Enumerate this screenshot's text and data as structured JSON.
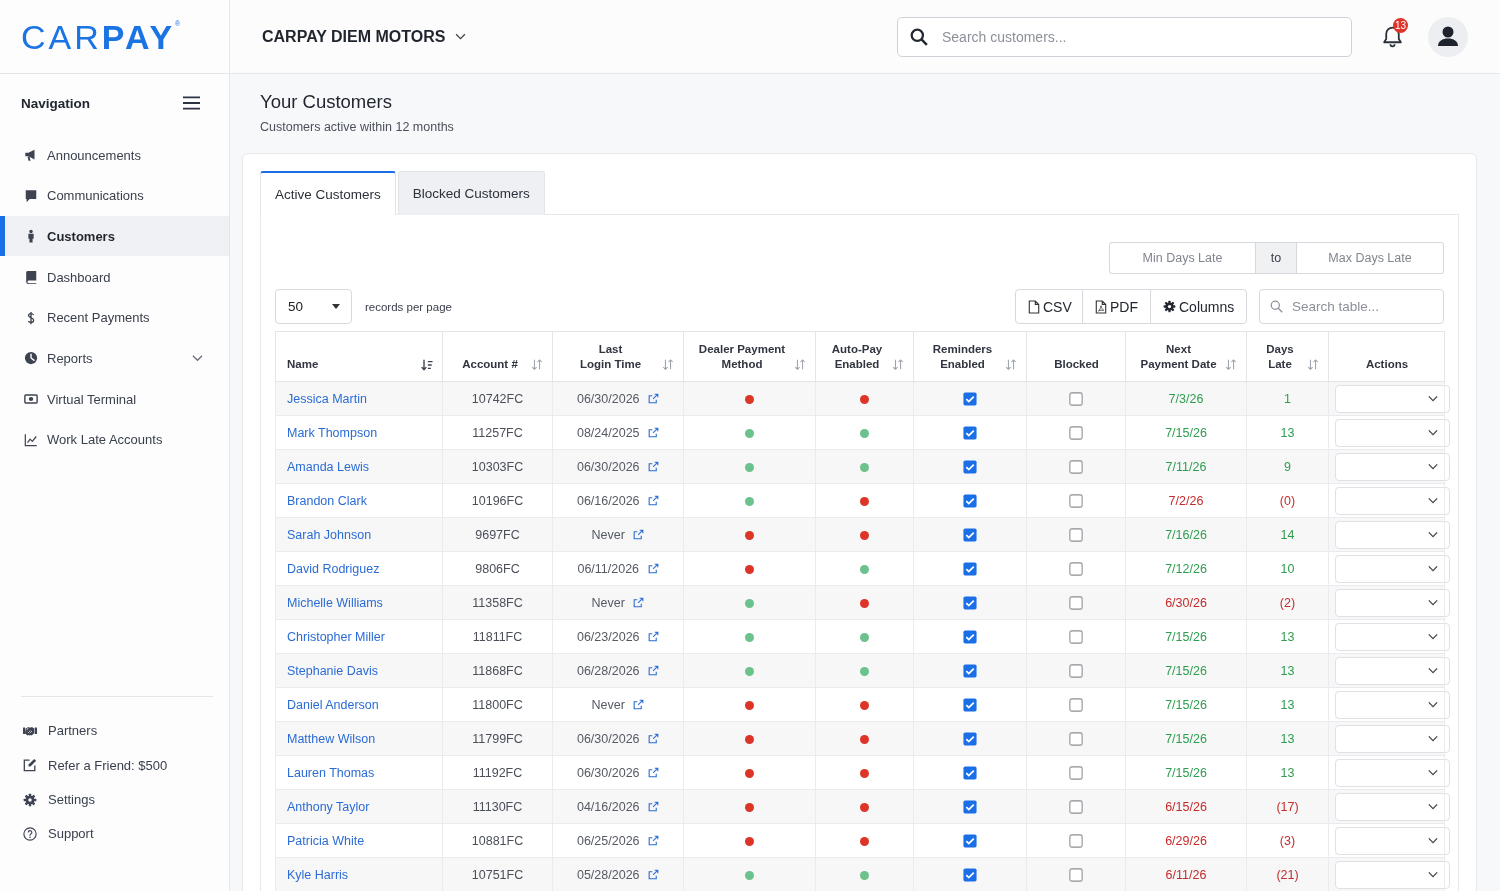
{
  "logo": "CAR**PAY**$^{®}$",
  "dealer_selector": {
    "label": "CARPAY DIEM MOTORS"
  },
  "search": {
    "placeholder": "Search customers..."
  },
  "notifications": {
    "count": "13"
  },
  "sidebar": {
    "heading": "Navigation",
    "items": [
      {
        "label": "Announcements",
        "kind": "link",
        "selected": false
      },
      {
        "label": "Communications",
        "kind": "link",
        "selected": false
      },
      {
        "label": "Customers",
        "kind": "link",
        "selected": true
      },
      {
        "label": "Dashboard",
        "kind": "link",
        "selected": false
      },
      {
        "label": "Recent Payments",
        "kind": "link",
        "selected": false
      },
      {
        "label": "Reports",
        "kind": "group",
        "selected": false,
        "expanded": false
      },
      {
        "label": "Virtual Terminal",
        "kind": "link",
        "selected": false
      },
      {
        "label": "Work Late Accounts",
        "kind": "link",
        "selected": false
      }
    ],
    "footer_items": [
      {
        "label": "Partners"
      },
      {
        "label": "Refer a Friend: $500"
      },
      {
        "label": "Settings"
      },
      {
        "label": "Support"
      }
    ]
  },
  "page": {
    "title": "Your Customers",
    "subtitle": "Customers active within 12 months"
  },
  "tabs": [
    {
      "label": "Active Customers",
      "selected": true
    },
    {
      "label": "Blocked Customers",
      "selected": false
    }
  ],
  "days_late_filter": {
    "min_placeholder": "Min Days Late",
    "separator": "to",
    "max_placeholder": "Max Days Late"
  },
  "page_size": {
    "value": "50",
    "label": "records per page"
  },
  "export_buttons": [
    "CSV",
    "PDF",
    "Columns"
  ],
  "table_search": {
    "placeholder": "Search table..."
  },
  "table": {
    "columns": [
      {
        "label": "Name",
        "sortable": true,
        "sorted": true
      },
      {
        "label": "Account #",
        "sortable": true,
        "sorted": false
      },
      {
        "label": "Last\nLogin Time",
        "sortable": true,
        "sorted": false
      },
      {
        "label": "Dealer Payment\nMethod",
        "sortable": true,
        "sorted": false
      },
      {
        "label": "Auto-Pay\nEnabled",
        "sortable": true,
        "sorted": false
      },
      {
        "label": "Reminders\nEnabled",
        "sortable": true,
        "sorted": false
      },
      {
        "label": "Blocked",
        "sortable": false,
        "sorted": false
      },
      {
        "label": "Next\nPayment Date",
        "sortable": true,
        "sorted": false
      },
      {
        "label": "Days\nLate",
        "sortable": true,
        "sorted": false
      },
      {
        "label": "Actions",
        "sortable": false,
        "sorted": false
      }
    ],
    "rows": [
      {
        "name": "Jessica Martin",
        "account": "10742FC",
        "last_login": "06/30/2026",
        "dealer_payment": {
          "color": "#dd3428"
        },
        "auto_pay": {
          "color": "#dd3428"
        },
        "reminders_enabled": true,
        "blocked": false,
        "next_payment_date": "7/3/26",
        "days_late": "1",
        "past_due": false
      },
      {
        "name": "Mark Thompson",
        "account": "11257FC",
        "last_login": "08/24/2025",
        "dealer_payment": {
          "color": "#6cc28c"
        },
        "auto_pay": {
          "color": "#6cc28c"
        },
        "reminders_enabled": true,
        "blocked": false,
        "next_payment_date": "7/15/26",
        "days_late": "13",
        "past_due": false
      },
      {
        "name": "Amanda Lewis",
        "account": "10303FC",
        "last_login": "06/30/2026",
        "dealer_payment": {
          "color": "#6cc28c"
        },
        "auto_pay": {
          "color": "#6cc28c"
        },
        "reminders_enabled": true,
        "blocked": false,
        "next_payment_date": "7/11/26",
        "days_late": "9",
        "past_due": false
      },
      {
        "name": "Brandon Clark",
        "account": "10196FC",
        "last_login": "06/16/2026",
        "dealer_payment": {
          "color": "#6cc28c"
        },
        "auto_pay": {
          "color": "#dd3428"
        },
        "reminders_enabled": true,
        "blocked": false,
        "next_payment_date": "7/2/26",
        "days_late": "(0)",
        "past_due": true
      },
      {
        "name": "Sarah Johnson",
        "account": "9697FC",
        "last_login": "Never",
        "dealer_payment": {
          "color": "#dd3428"
        },
        "auto_pay": {
          "color": "#dd3428"
        },
        "reminders_enabled": true,
        "blocked": false,
        "next_payment_date": "7/16/26",
        "days_late": "14",
        "past_due": false
      },
      {
        "name": "David Rodriguez",
        "account": "9806FC",
        "last_login": "06/11/2026",
        "dealer_payment": {
          "color": "#dd3428"
        },
        "auto_pay": {
          "color": "#6cc28c"
        },
        "reminders_enabled": true,
        "blocked": false,
        "next_payment_date": "7/12/26",
        "days_late": "10",
        "past_due": false
      },
      {
        "name": "Michelle Williams",
        "account": "11358FC",
        "last_login": "Never",
        "dealer_payment": {
          "color": "#6cc28c"
        },
        "auto_pay": {
          "color": "#dd3428"
        },
        "reminders_enabled": true,
        "blocked": false,
        "next_payment_date": "6/30/26",
        "days_late": "(2)",
        "past_due": true
      },
      {
        "name": "Christopher Miller",
        "account": "11811FC",
        "last_login": "06/23/2026",
        "dealer_payment": {
          "color": "#6cc28c"
        },
        "auto_pay": {
          "color": "#6cc28c"
        },
        "reminders_enabled": true,
        "blocked": false,
        "next_payment_date": "7/15/26",
        "days_late": "13",
        "past_due": false
      },
      {
        "name": "Stephanie Davis",
        "account": "11868FC",
        "last_login": "06/28/2026",
        "dealer_payment": {
          "color": "#6cc28c"
        },
        "auto_pay": {
          "color": "#6cc28c"
        },
        "reminders_enabled": true,
        "blocked": false,
        "next_payment_date": "7/15/26",
        "days_late": "13",
        "past_due": false
      },
      {
        "name": "Daniel Anderson",
        "account": "11800FC",
        "last_login": "Never",
        "dealer_payment": {
          "color": "#dd3428"
        },
        "auto_pay": {
          "color": "#dd3428"
        },
        "reminders_enabled": true,
        "blocked": false,
        "next_payment_date": "7/15/26",
        "days_late": "13",
        "past_due": false
      },
      {
        "name": "Matthew Wilson",
        "account": "11799FC",
        "last_login": "06/30/2026",
        "dealer_payment": {
          "color": "#dd3428"
        },
        "auto_pay": {
          "color": "#dd3428"
        },
        "reminders_enabled": true,
        "blocked": false,
        "next_payment_date": "7/15/26",
        "days_late": "13",
        "past_due": false
      },
      {
        "name": "Lauren Thomas",
        "account": "11192FC",
        "last_login": "06/30/2026",
        "dealer_payment": {
          "color": "#dd3428"
        },
        "auto_pay": {
          "color": "#dd3428"
        },
        "reminders_enabled": true,
        "blocked": false,
        "next_payment_date": "7/15/26",
        "days_late": "13",
        "past_due": false
      },
      {
        "name": "Anthony Taylor",
        "account": "11130FC",
        "last_login": "04/16/2026",
        "dealer_payment": {
          "color": "#dd3428"
        },
        "auto_pay": {
          "color": "#dd3428"
        },
        "reminders_enabled": true,
        "blocked": false,
        "next_payment_date": "6/15/26",
        "days_late": "(17)",
        "past_due": true
      },
      {
        "name": "Patricia White",
        "account": "10881FC",
        "last_login": "06/25/2026",
        "dealer_payment": {
          "color": "#dd3428"
        },
        "auto_pay": {
          "color": "#dd3428"
        },
        "reminders_enabled": true,
        "blocked": false,
        "next_payment_date": "6/29/26",
        "days_late": "(3)",
        "past_due": true
      },
      {
        "name": "Kyle Harris",
        "account": "10751FC",
        "last_login": "05/28/2026",
        "dealer_payment": {
          "color": "#6cc28c"
        },
        "auto_pay": {
          "color": "#6cc28c"
        },
        "reminders_enabled": true,
        "blocked": false,
        "next_payment_date": "6/11/26",
        "days_late": "(21)",
        "past_due": true
      }
    ]
  }
}
